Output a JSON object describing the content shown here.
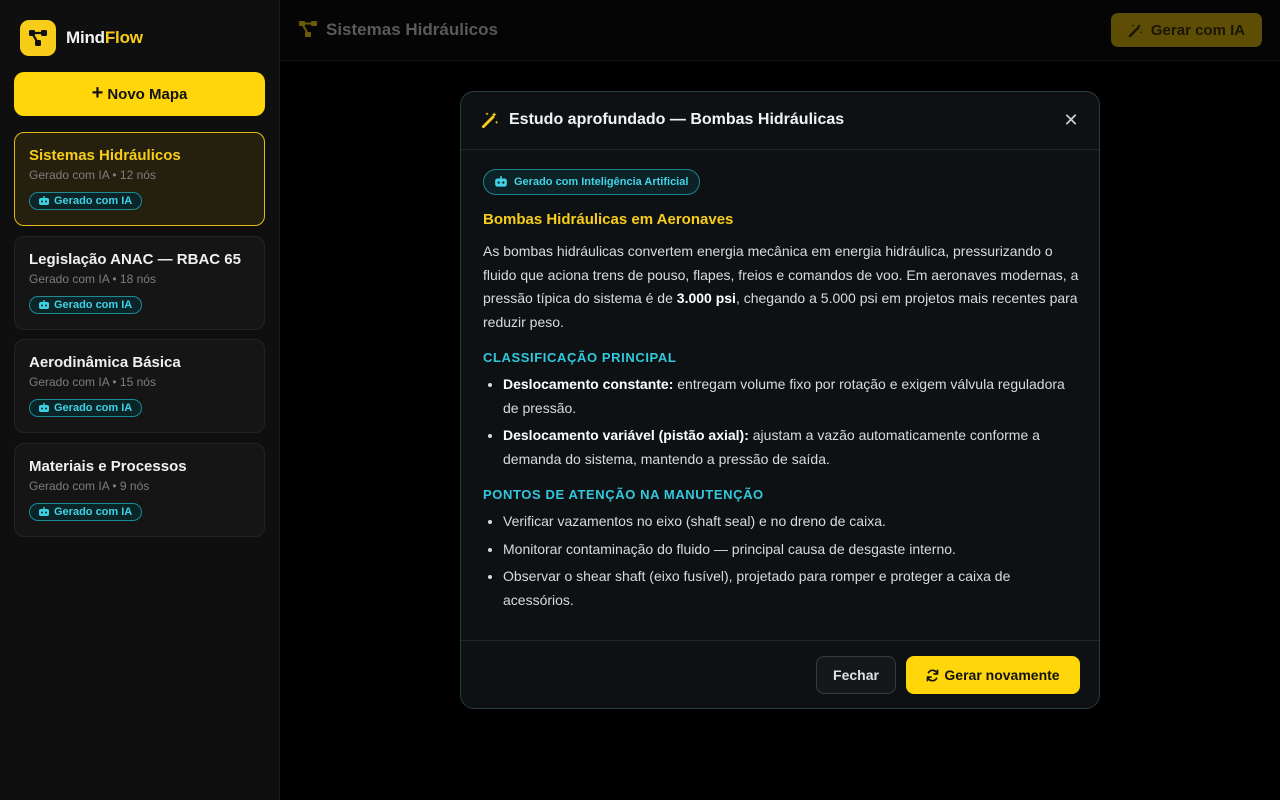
{
  "colors": {
    "accent": "#ffd60a",
    "ai_badge": "#3fd2e4",
    "section_heading": "#32c8dc",
    "background": "#000000"
  },
  "brand": {
    "name_part1": "Mind",
    "name_part2": "Flow",
    "logo_icon": "share-nodes-icon"
  },
  "sidebar": {
    "new_map_label": "Novo Mapa",
    "new_map_icon": "plus-icon",
    "maps": [
      {
        "title": "Sistemas Hidráulicos",
        "meta": "Gerado com IA • 12 nós",
        "badge": "Gerado com IA",
        "active": true
      },
      {
        "title": "Legislação ANAC — RBAC 65",
        "meta": "Gerado com IA • 18 nós",
        "badge": "Gerado com IA",
        "active": false
      },
      {
        "title": "Aerodinâmica Básica",
        "meta": "Gerado com IA • 15 nós",
        "badge": "Gerado com IA",
        "active": false
      },
      {
        "title": "Materiais e Processos",
        "meta": "Gerado com IA • 9 nós",
        "badge": "Gerado com IA",
        "active": false
      }
    ]
  },
  "header": {
    "title": "Sistemas Hidráulicos",
    "title_icon": "sitemap-icon",
    "generate_button": "Gerar com IA",
    "generate_icon": "magic-wand-icon"
  },
  "modal": {
    "title": "Estudo aprofundado — Bombas Hidráulicas",
    "title_icon": "magic-wand-icon",
    "close_icon": "close-icon",
    "ai_pill": "Gerado com Inteligência Artificial",
    "heading": "Bombas Hidráulicas em Aeronaves",
    "paragraph": {
      "part1": "As bombas hidráulicas convertem energia mecânica em energia hidráulica, pressurizando o fluido que aciona trens de pouso, flapes, freios e comandos de voo. Em aeronaves modernas, a pressão típica do sistema é de ",
      "bold": "3.000 psi",
      "part2": ", chegando a 5.000 psi em projetos mais recentes para reduzir peso."
    },
    "section1": {
      "title": "CLASSIFICAÇÃO PRINCIPAL",
      "items": [
        {
          "bold": "Deslocamento constante:",
          "text": " entregam volume fixo por rotação e exigem válvula reguladora de pressão."
        },
        {
          "bold": "Deslocamento variável (pistão axial):",
          "text": " ajustam a vazão automaticamente conforme a demanda do sistema, mantendo a pressão de saída."
        }
      ]
    },
    "section2": {
      "title": "PONTOS DE ATENÇÃO NA MANUTENÇÃO",
      "items": [
        "Verificar vazamentos no eixo (shaft seal) e no dreno de caixa.",
        "Monitorar contaminação do fluido — principal causa de desgaste interno.",
        "Observar o shear shaft (eixo fusível), projetado para romper e proteger a caixa de acessórios."
      ]
    },
    "close_button": "Fechar",
    "regenerate_button": "Gerar novamente",
    "regenerate_icon": "refresh-icon"
  }
}
